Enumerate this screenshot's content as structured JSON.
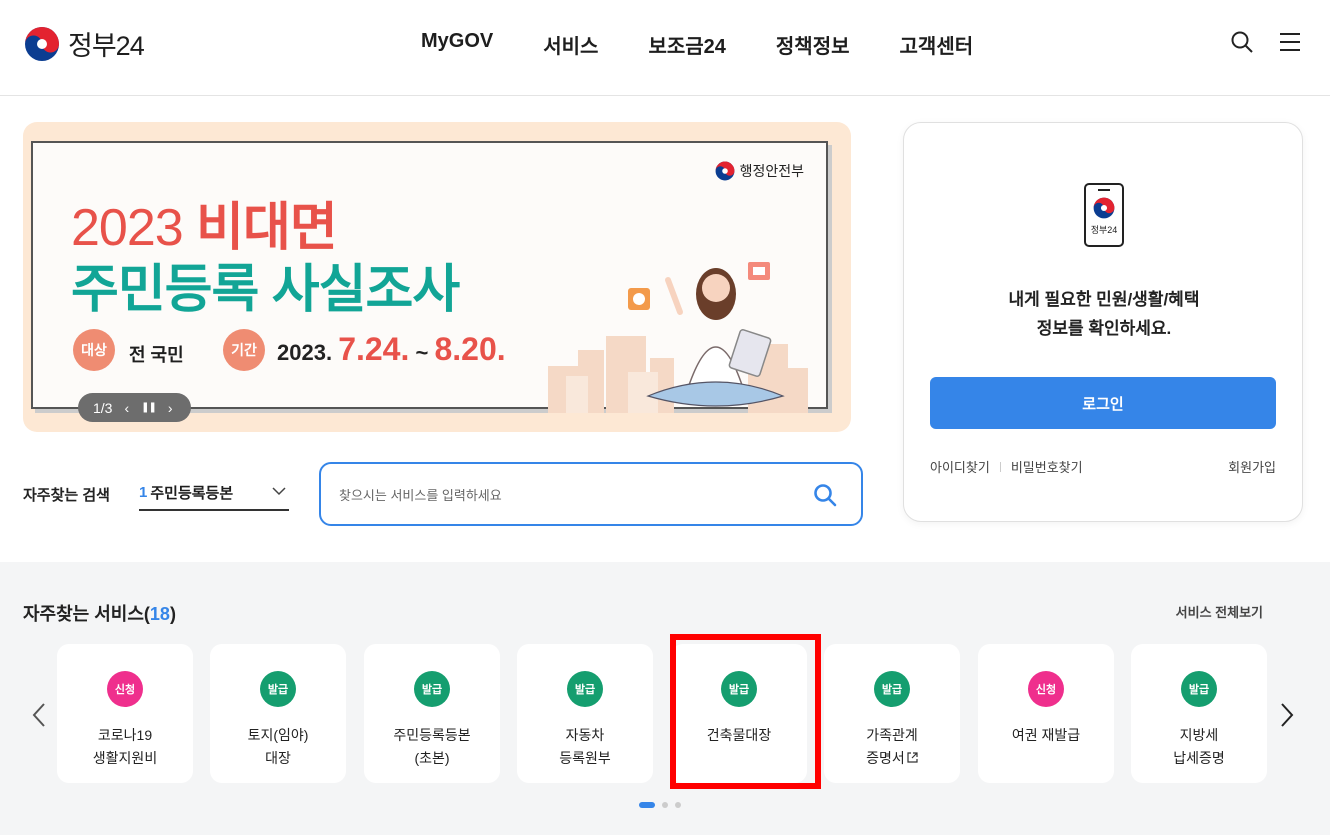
{
  "header": {
    "logo_text": "정부24",
    "nav": [
      "MyGOV",
      "서비스",
      "보조금24",
      "정책정보",
      "고객센터"
    ]
  },
  "banner": {
    "ministry": "행정안전부",
    "title_year": "2023",
    "title_emph": "비대면",
    "title_line2": "주민등록 사실조사",
    "target_pill": "대상",
    "target_value": "전 국민",
    "period_pill": "기간",
    "period_prefix": "2023.",
    "period_start": "7.24.",
    "period_sep": "~",
    "period_end": "8.20.",
    "slide_counter": "1/3"
  },
  "login": {
    "phone_label": "정부24",
    "message_line1": "내게 필요한 민원/생활/혜택",
    "message_line2": "정보를 확인하세요.",
    "login_button": "로그인",
    "find_id": "아이디찾기",
    "find_password": "비밀번호찾기",
    "signup": "회원가입"
  },
  "frequent_search": {
    "label": "자주찾는 검색",
    "selected_rank": "1",
    "selected_value": "주민등록등본",
    "placeholder": "찾으시는 서비스를 입력하세요"
  },
  "services": {
    "title": "자주찾는 서비스(",
    "count": "18",
    "title_end": ")",
    "view_all": "서비스 전체보기",
    "cards": [
      {
        "badge": "신청",
        "type": "apply",
        "name": "코로나19\n생활지원비"
      },
      {
        "badge": "발급",
        "type": "issue",
        "name": "토지(임야)\n대장"
      },
      {
        "badge": "발급",
        "type": "issue",
        "name": "주민등록등본\n(초본)"
      },
      {
        "badge": "발급",
        "type": "issue",
        "name": "자동차\n등록원부"
      },
      {
        "badge": "발급",
        "type": "issue",
        "name": "건축물대장"
      },
      {
        "badge": "발급",
        "type": "issue",
        "name": "가족관계\n증명서"
      },
      {
        "badge": "신청",
        "type": "apply",
        "name": "여권 재발급"
      },
      {
        "badge": "발급",
        "type": "issue",
        "name": "지방세\n납세증명"
      }
    ],
    "pager_pages": 3,
    "pager_active": 1
  },
  "colors": {
    "primary": "#3585e8",
    "issue_badge": "#159e6f",
    "apply_badge": "#ef2f8d",
    "highlight": "#ff0000"
  }
}
